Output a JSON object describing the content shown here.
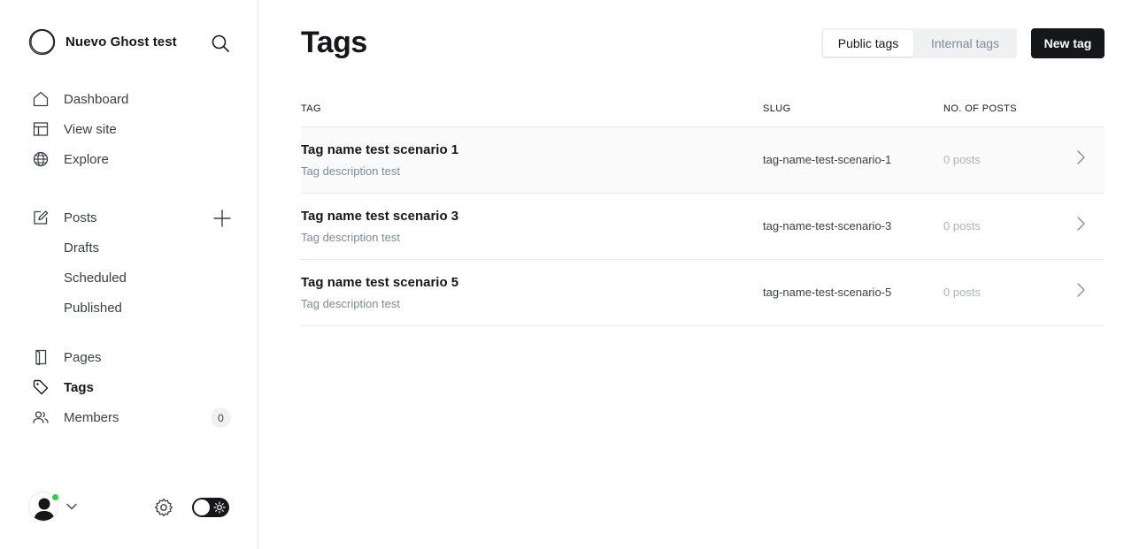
{
  "brand": {
    "name": "Nuevo Ghost test"
  },
  "nav": {
    "dashboard": "Dashboard",
    "view_site": "View site",
    "explore": "Explore",
    "posts": "Posts",
    "drafts": "Drafts",
    "scheduled": "Scheduled",
    "published": "Published",
    "pages": "Pages",
    "tags": "Tags",
    "members": "Members",
    "members_count": "0"
  },
  "header": {
    "title": "Tags",
    "public_tab": "Public tags",
    "internal_tab": "Internal tags",
    "new_button": "New tag"
  },
  "table": {
    "columns": [
      "TAG",
      "SLUG",
      "NO. OF POSTS"
    ],
    "rows": [
      {
        "name": "Tag name test scenario 1",
        "description": "Tag description test",
        "slug": "tag-name-test-scenario-1",
        "count": "0 posts"
      },
      {
        "name": "Tag name test scenario 3",
        "description": "Tag description test",
        "slug": "tag-name-test-scenario-3",
        "count": "0 posts"
      },
      {
        "name": "Tag name test scenario 5",
        "description": "Tag description test",
        "slug": "tag-name-test-scenario-5",
        "count": "0 posts"
      }
    ]
  },
  "colors": {
    "accent": "#15171a",
    "online": "#30cf43",
    "muted": "#7c8b9a",
    "border": "#e6e9eb"
  },
  "icons": [
    "ghost-logo-icon",
    "search-icon",
    "home-icon",
    "view-site-icon",
    "globe-icon",
    "edit-icon",
    "plus-icon",
    "pages-icon",
    "tag-icon",
    "members-icon",
    "user-avatar-icon",
    "chevron-down-icon",
    "gear-icon",
    "sun-icon",
    "chevron-right-icon"
  ]
}
